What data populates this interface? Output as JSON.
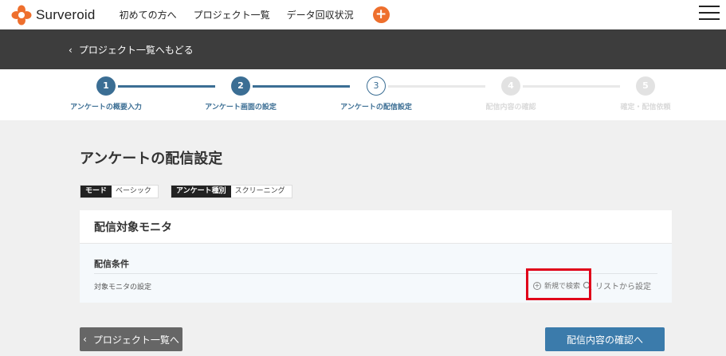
{
  "header": {
    "brand": "Surveroid",
    "nav": [
      "初めての方へ",
      "プロジェクト一覧",
      "データ回収状況"
    ],
    "add_label": "+",
    "logo_icon": "flower-logo-icon",
    "menu_icon": "hamburger-icon",
    "accent_color": "#ee6f2d"
  },
  "subheader": {
    "back_chevron": "‹",
    "back_label": "プロジェクト一覧へもどる"
  },
  "stepper": {
    "current_step": 3,
    "steps": [
      {
        "num": "1",
        "label": "アンケートの概要入力"
      },
      {
        "num": "2",
        "label": "アンケート画面の設定"
      },
      {
        "num": "3",
        "label": "アンケートの配信設定"
      },
      {
        "num": "4",
        "label": "配信内容の確認"
      },
      {
        "num": "5",
        "label": "確定・配信依頼"
      }
    ]
  },
  "main": {
    "title": "アンケートの配信設定",
    "badges": [
      {
        "key": "モード",
        "value": "ベーシック"
      },
      {
        "key": "アンケート種別",
        "value": "スクリーニング"
      }
    ],
    "card": {
      "title": "配信対象モニタ",
      "condition_title": "配信条件",
      "row_label": "対象モニタの設定",
      "action_new_icon": "circle-plus-icon",
      "action_new": "新規で検索",
      "action_list_icon": "search-icon",
      "action_list": "リストから設定"
    }
  },
  "footer": {
    "back_chevron": "‹",
    "back_button": "プロジェクト一覧へ",
    "confirm_button": "配信内容の確認へ"
  }
}
